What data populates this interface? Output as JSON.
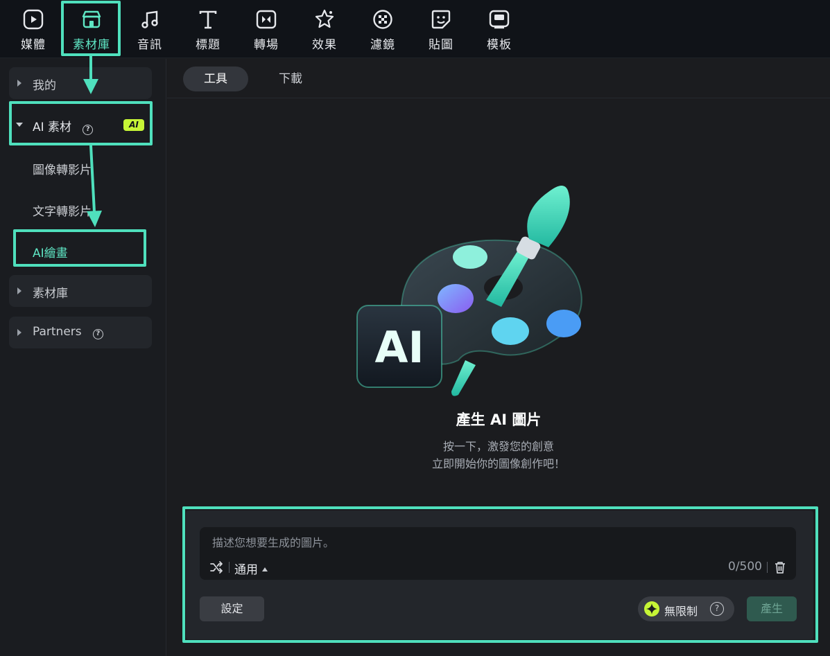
{
  "top_tabs": [
    {
      "label": "媒體",
      "icon": "media-icon"
    },
    {
      "label": "素材庫",
      "icon": "store-icon"
    },
    {
      "label": "音訊",
      "icon": "music-icon"
    },
    {
      "label": "標題",
      "icon": "title-icon"
    },
    {
      "label": "轉場",
      "icon": "transition-icon"
    },
    {
      "label": "效果",
      "icon": "effects-icon"
    },
    {
      "label": "濾鏡",
      "icon": "filter-icon"
    },
    {
      "label": "貼圖",
      "icon": "sticker-icon"
    },
    {
      "label": "模板",
      "icon": "template-icon"
    }
  ],
  "active_top_tab": "素材庫",
  "sidebar": {
    "mine": "我的",
    "ai_assets": "AI 素材",
    "ai_badge": "AI",
    "items": [
      "圖像轉影片",
      "文字轉影片",
      "AI繪畫"
    ],
    "library": "素材庫",
    "partners": "Partners",
    "help_glyph": "?"
  },
  "subtabs": [
    "工具",
    "下載"
  ],
  "hero": {
    "badge_text": "AI",
    "title": "產生 AI 圖片",
    "line1": "按一下，激發您的創意",
    "line2": "立即開始你的圖像創作吧！"
  },
  "composer": {
    "placeholder": "描述您想要生成的圖片。",
    "style": "通用",
    "counter": "0/500",
    "settings": "設定",
    "unlimited": "無限制",
    "help_glyph": "?",
    "generate": "產生"
  },
  "colors": {
    "accent": "#5fe6c4",
    "highlight": "#4fe0bd",
    "ai_badge": "#c6f536"
  }
}
